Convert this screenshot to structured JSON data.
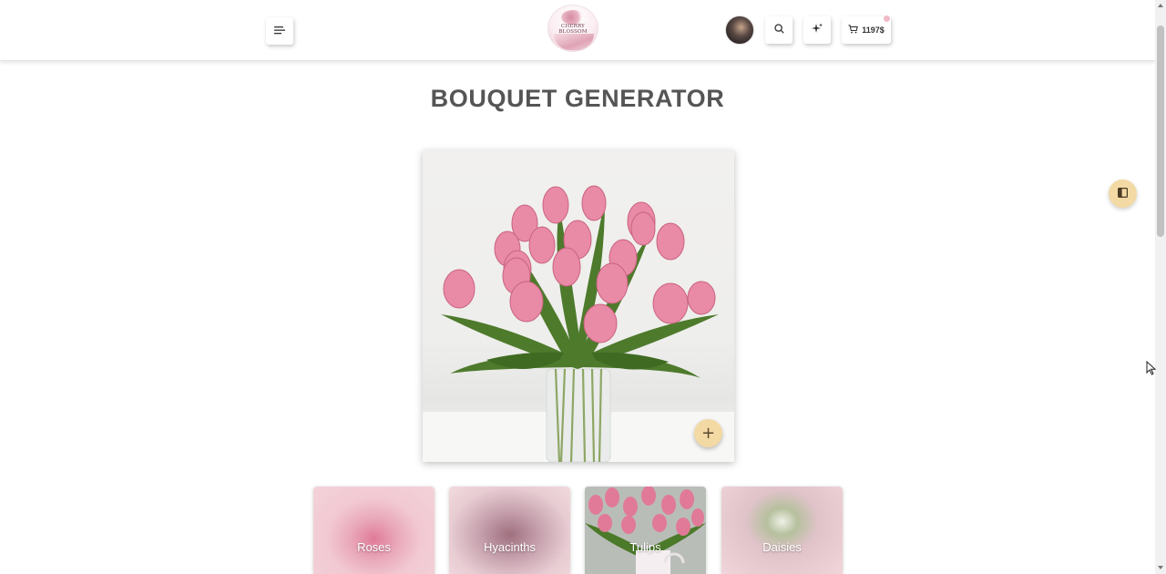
{
  "header": {
    "logo_text": "CHERRY BLOSSOM",
    "cart_total": "1197$"
  },
  "page": {
    "title": "BOUQUET GENERATOR"
  },
  "main_image": {
    "add_label": "+"
  },
  "thumbnails": [
    {
      "label": "Roses"
    },
    {
      "label": "Hyacinths"
    },
    {
      "label": "Tulips"
    },
    {
      "label": "Daisies"
    }
  ],
  "colors": {
    "accent": "#f3d9a4",
    "title": "#555555",
    "tulip_pink": "#e98aa6"
  }
}
